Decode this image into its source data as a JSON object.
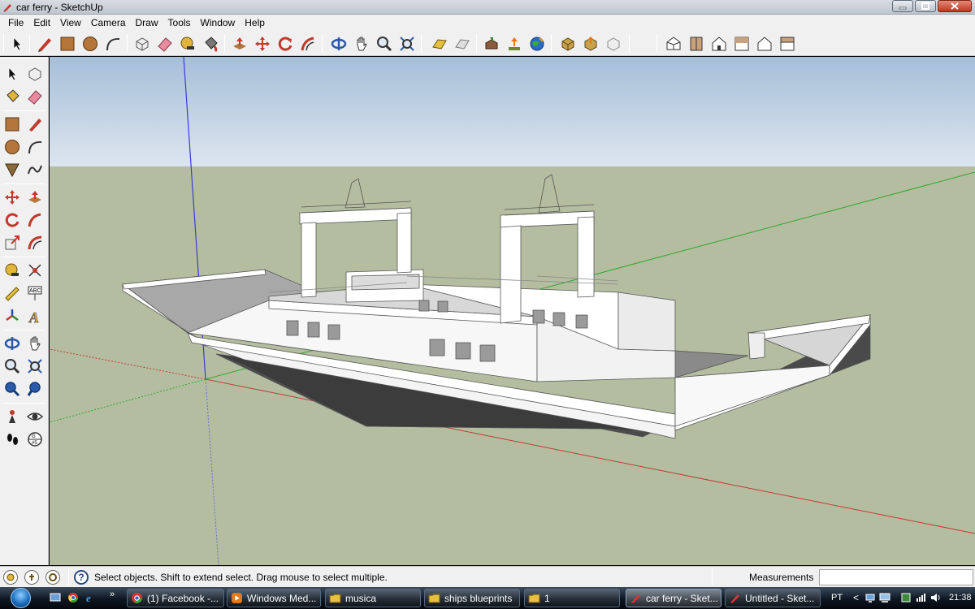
{
  "window": {
    "title": "car ferry - SketchUp",
    "app_icon": "sketchup-pencil-icon",
    "controls": [
      "minimize-icon",
      "maximize-icon",
      "close-icon"
    ]
  },
  "menu": {
    "items": [
      "File",
      "Edit",
      "View",
      "Camera",
      "Draw",
      "Tools",
      "Window",
      "Help"
    ]
  },
  "toolbar": {
    "tools": [
      "select-icon",
      "pencil-line-icon",
      "rectangle-icon",
      "circle-icon",
      "arc-icon",
      "make-component-icon",
      "eraser-icon",
      "tape-measure-icon",
      "paint-bucket-icon",
      "push-pull-icon",
      "move-icon",
      "rotate-icon",
      "follow-me-icon",
      "orbit-icon",
      "pan-icon",
      "zoom-icon",
      "zoom-extents-icon",
      "add-location-icon",
      "toggle-terrain-icon",
      "get-models-icon",
      "share-model-icon",
      "google-earth-icon",
      "get-component-icon",
      "share-component-icon",
      "component-3d-icon",
      "iso-view-icon",
      "top-view-icon",
      "front-view-icon",
      "right-view-icon",
      "back-view-icon",
      "left-view-icon"
    ]
  },
  "palette": {
    "tools": [
      "select-icon",
      "make-component-icon",
      "paint-bucket-icon",
      "eraser-icon",
      "rectangle-icon",
      "pencil-line-icon",
      "circle-icon",
      "arc-icon",
      "polygon-icon",
      "freehand-icon",
      "move-icon",
      "push-pull-icon",
      "rotate-icon",
      "follow-me-icon",
      "scale-icon",
      "offset-icon",
      "tape-measure-icon",
      "dimension-icon",
      "protractor-icon",
      "text-icon",
      "axes-icon",
      "3d-text-icon",
      "orbit-icon",
      "pan-icon",
      "zoom-icon",
      "zoom-window-icon",
      "previous-view-icon",
      "next-view-icon",
      "position-camera-icon",
      "look-around-icon",
      "walk-icon",
      "section-plane-icon"
    ]
  },
  "viewport": {
    "sky_color": "#a9c3dc",
    "ground_color": "#b4bda0",
    "axis_colors": {
      "blue": "#3a3ad8",
      "green": "#2fa82f",
      "red": "#c23a3a"
    },
    "model": "car-ferry-model"
  },
  "status": {
    "indicator_icons": [
      "geo-location-icon",
      "credit-icon",
      "user-icon"
    ],
    "help_icon": "?",
    "message": "Select objects. Shift to extend select. Drag mouse to select multiple.",
    "measurements_label": "Measurements",
    "measurements_value": ""
  },
  "taskbar": {
    "quick_launch": [
      "show-desktop-icon",
      "chrome-icon",
      "internet-explorer-icon"
    ],
    "overflow": "»",
    "tasks": [
      {
        "label": "(1) Facebook -...",
        "icon": "chrome-icon",
        "active": false
      },
      {
        "label": "Windows Med...",
        "icon": "media-player-icon",
        "active": false
      },
      {
        "label": "musica",
        "icon": "folder-icon",
        "active": false
      },
      {
        "label": "ships blueprints",
        "icon": "folder-icon",
        "active": false
      },
      {
        "label": "1",
        "icon": "folder-icon",
        "active": false
      },
      {
        "label": "car ferry - Sket...",
        "icon": "sketchup-pencil-icon",
        "active": true
      },
      {
        "label": "Untitled - Sket...",
        "icon": "sketchup-pencil-icon",
        "active": false
      }
    ],
    "tray": {
      "language": "PT",
      "expand": "<",
      "icons": [
        "network-icon",
        "monitor-icon",
        "tray-app-icon",
        "wifi-icon",
        "volume-icon"
      ],
      "clock": "21:38"
    }
  }
}
